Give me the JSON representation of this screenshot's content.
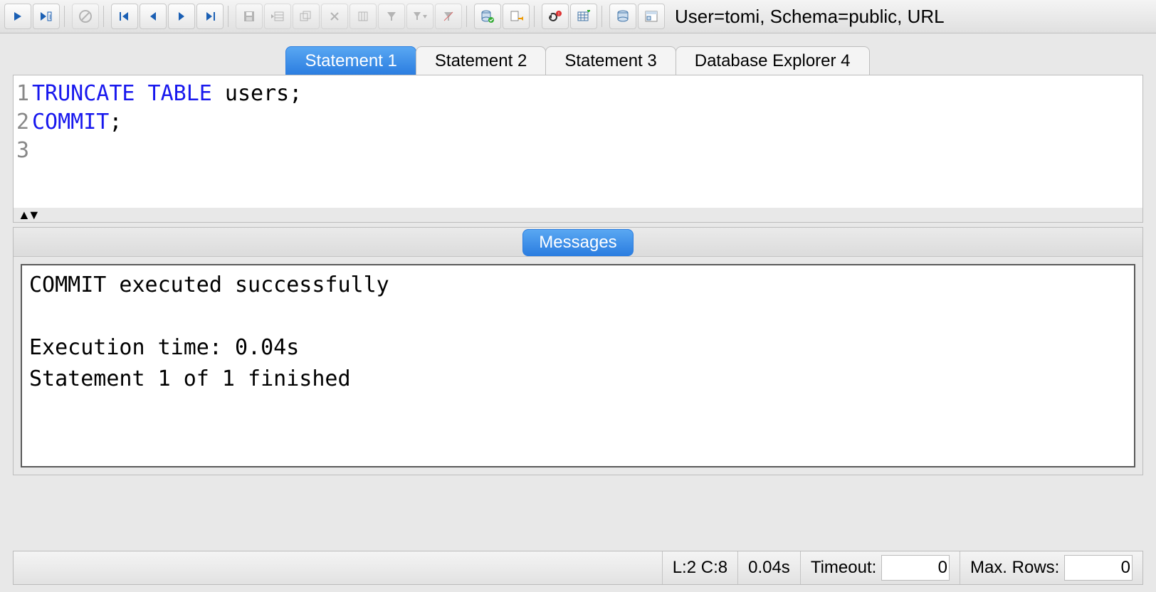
{
  "connection_info": "User=tomi, Schema=public, URL",
  "toolbar": {
    "run": "run-icon",
    "run_current": "run-current-icon",
    "stop": "stop-icon",
    "first": "first-icon",
    "prev": "prev-icon",
    "next": "next-icon",
    "last": "last-icon",
    "save": "save-icon",
    "insert_row": "insert-row-icon",
    "copy_row": "copy-row-icon",
    "delete_row": "delete-row-icon",
    "filter": "filter-icon",
    "filter_apply": "filter-apply-icon",
    "filter_reset": "filter-reset-icon",
    "commit": "commit-icon",
    "rollback": "rollback-icon",
    "autocommit": "autocommit-toggle-icon",
    "show_tables": "show-tables-icon",
    "show_db": "show-db-icon",
    "show_procs": "show-procs-icon"
  },
  "tabs": [
    {
      "label": "Statement 1",
      "active": true
    },
    {
      "label": "Statement 2",
      "active": false
    },
    {
      "label": "Statement 3",
      "active": false
    },
    {
      "label": "Database Explorer 4",
      "active": false
    }
  ],
  "editor": {
    "lines": [
      {
        "n": "1",
        "tokens": [
          {
            "t": "TRUNCATE TABLE",
            "kw": true
          },
          {
            "t": " users;",
            "kw": false
          }
        ]
      },
      {
        "n": "2",
        "tokens": [
          {
            "t": "COMMIT",
            "kw": true
          },
          {
            "t": ";",
            "kw": false
          }
        ]
      },
      {
        "n": "3",
        "tokens": []
      }
    ]
  },
  "messages": {
    "tab_label": "Messages",
    "text": "COMMIT executed successfully\n\nExecution time: 0.04s\nStatement 1 of 1 finished\n"
  },
  "status": {
    "cursor": "L:2 C:8",
    "exec_time": "0.04s",
    "timeout_label": "Timeout:",
    "timeout_value": "0",
    "maxrows_label": "Max. Rows:",
    "maxrows_value": "0"
  }
}
